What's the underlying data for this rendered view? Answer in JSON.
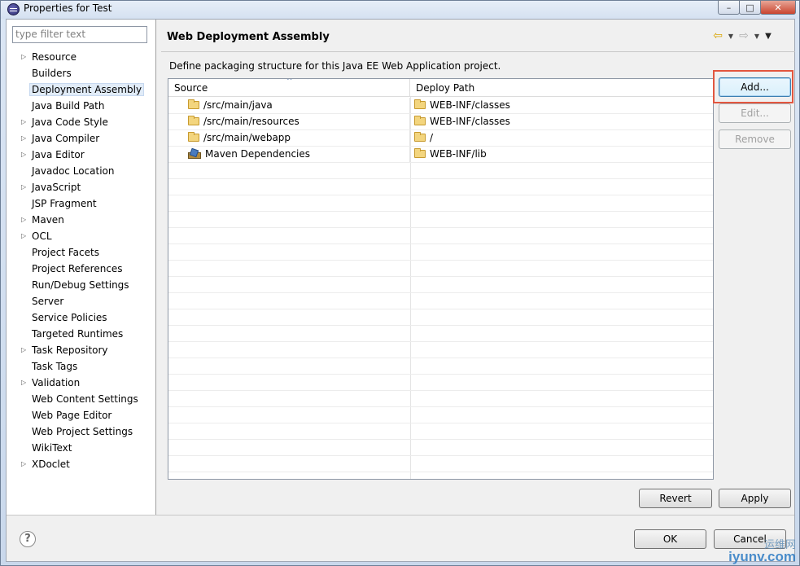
{
  "window": {
    "title": "Properties for Test",
    "controls": {
      "minimize": "–",
      "maximize": "□",
      "close": "✕"
    }
  },
  "filter": {
    "placeholder": "type filter text"
  },
  "tree": {
    "selected_index": 2,
    "items": [
      {
        "label": "Resource",
        "expandable": true
      },
      {
        "label": "Builders",
        "expandable": false
      },
      {
        "label": "Deployment Assembly",
        "expandable": false
      },
      {
        "label": "Java Build Path",
        "expandable": false
      },
      {
        "label": "Java Code Style",
        "expandable": true
      },
      {
        "label": "Java Compiler",
        "expandable": true
      },
      {
        "label": "Java Editor",
        "expandable": true
      },
      {
        "label": "Javadoc Location",
        "expandable": false
      },
      {
        "label": "JavaScript",
        "expandable": true
      },
      {
        "label": "JSP Fragment",
        "expandable": false
      },
      {
        "label": "Maven",
        "expandable": true
      },
      {
        "label": "OCL",
        "expandable": true
      },
      {
        "label": "Project Facets",
        "expandable": false
      },
      {
        "label": "Project References",
        "expandable": false
      },
      {
        "label": "Run/Debug Settings",
        "expandable": false
      },
      {
        "label": "Server",
        "expandable": false
      },
      {
        "label": "Service Policies",
        "expandable": false
      },
      {
        "label": "Targeted Runtimes",
        "expandable": false
      },
      {
        "label": "Task Repository",
        "expandable": true
      },
      {
        "label": "Task Tags",
        "expandable": false
      },
      {
        "label": "Validation",
        "expandable": true
      },
      {
        "label": "Web Content Settings",
        "expandable": false
      },
      {
        "label": "Web Page Editor",
        "expandable": false
      },
      {
        "label": "Web Project Settings",
        "expandable": false
      },
      {
        "label": "WikiText",
        "expandable": false
      },
      {
        "label": "XDoclet",
        "expandable": true
      }
    ]
  },
  "page": {
    "title": "Web Deployment Assembly",
    "description": "Define packaging structure for this Java EE Web Application project.",
    "nav": {
      "back_icon": "back-arrow-icon",
      "forward_icon": "forward-arrow-icon",
      "menu_icon": "view-menu-icon"
    }
  },
  "table": {
    "columns": {
      "source": "Source",
      "deploy_path": "Deploy Path"
    },
    "rows": [
      {
        "source": "/src/main/java",
        "deploy_path": "WEB-INF/classes",
        "icon": "folder-icon"
      },
      {
        "source": "/src/main/resources",
        "deploy_path": "WEB-INF/classes",
        "icon": "folder-icon"
      },
      {
        "source": "/src/main/webapp",
        "deploy_path": "/",
        "icon": "folder-icon"
      },
      {
        "source": "Maven Dependencies",
        "deploy_path": "WEB-INF/lib",
        "icon": "library-icon"
      }
    ],
    "empty_rows": 19
  },
  "buttons": {
    "add": "Add...",
    "edit": "Edit...",
    "remove": "Remove",
    "revert": "Revert",
    "apply": "Apply",
    "ok": "OK",
    "cancel": "Cancel"
  },
  "help": {
    "glyph": "?"
  },
  "watermark": {
    "top": "运维网",
    "bottom": "iyunv.com"
  }
}
